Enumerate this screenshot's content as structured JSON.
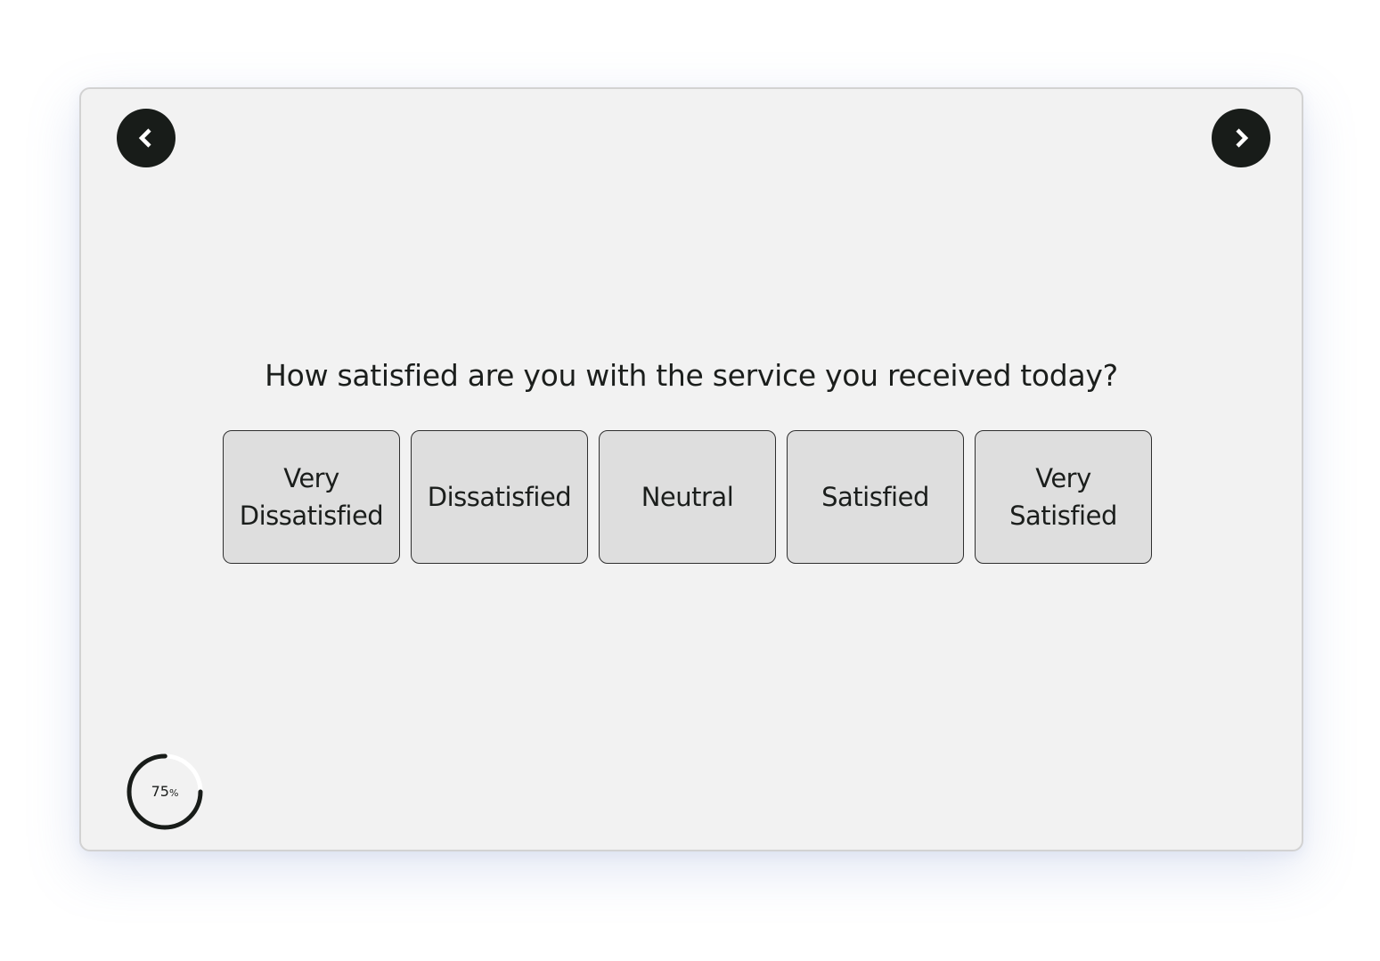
{
  "survey": {
    "question": "How satisfied are you with the service you received today?",
    "options": [
      {
        "line1": "Very",
        "line2": "Dissatisfied"
      },
      {
        "line1": "Dissatisfied",
        "line2": ""
      },
      {
        "line1": "Neutral",
        "line2": ""
      },
      {
        "line1": "Satisfied",
        "line2": ""
      },
      {
        "line1": "Very",
        "line2": "Satisfied"
      }
    ]
  },
  "navigation": {
    "prev_icon": "chevron-left-icon",
    "next_icon": "chevron-right-icon"
  },
  "progress": {
    "value": 75,
    "number": "75",
    "unit": "%",
    "fill_color": "#181c19",
    "track_color": "#ffffff"
  },
  "colors": {
    "card_background": "#f2f2f2",
    "option_background": "#dedede",
    "nav_button": "#181c19",
    "text": "#1b1e1c"
  }
}
